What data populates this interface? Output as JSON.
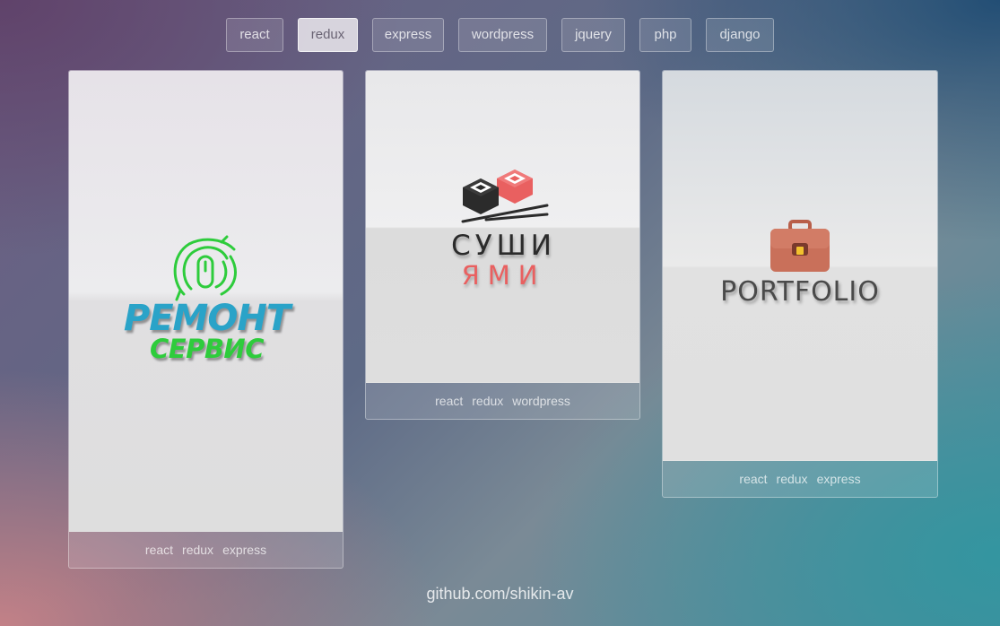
{
  "filters": {
    "items": [
      "react",
      "redux",
      "express",
      "wordpress",
      "jquery",
      "php",
      "django"
    ],
    "active": "redux"
  },
  "projects": [
    {
      "logo": {
        "title": "РЕМОНТ",
        "subtitle": "СЕРВИС",
        "icon": "phone-target-icon",
        "title_color": "#2aa3c8",
        "subtitle_color": "#2ecc3c"
      },
      "tags": [
        "react",
        "redux",
        "express"
      ]
    },
    {
      "logo": {
        "title": "СУШИ",
        "subtitle": "ЯМИ",
        "icon": "sushi-rolls-chopsticks-icon",
        "title_color": "#2b2b2b",
        "subtitle_color": "#e96060"
      },
      "tags": [
        "react",
        "redux",
        "wordpress"
      ]
    },
    {
      "logo": {
        "title": "PORTFOLIO",
        "icon": "briefcase-icon",
        "title_color": "#4a4a4a",
        "accent_color": "#c9705a"
      },
      "tags": [
        "react",
        "redux",
        "express"
      ]
    }
  ],
  "footer": {
    "link": "github.com/shikin-av"
  }
}
